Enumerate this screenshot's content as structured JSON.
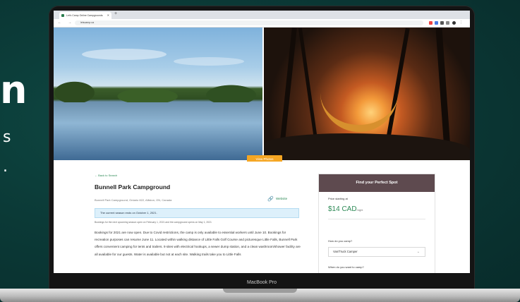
{
  "background": {
    "letter": "n",
    "line2": "s",
    "line3": "."
  },
  "device": {
    "label": "MacBook Pro"
  },
  "browser": {
    "tab_title": "Let's Camp Online Campgrounds",
    "url": "letscamp.ca",
    "nav_icons": "← → ⟳"
  },
  "hero": {
    "view_photos_label": "View Photos"
  },
  "listing": {
    "back_label": "← Back to Search",
    "title": "Bunnell Park Campground",
    "address": "Bunnell Park Campground, Ontario 822, Alliston, ON, Canada",
    "website_label": "Website",
    "notice": "The current season ends on October 1, 2021.",
    "small_note": "Bookings for the next upcoming season open on February 1, 2021 and the campground opens on May 1, 2021",
    "description": "Bookings for 2021 are now open. Due to Covid restrictions, the camp is only available to essential workers until June 10. Bookings for recreation purposes can resume June 11. Located within walking distance of Little Falls Golf Course and picturesque Little Falls, Bunnell Park offers convenient camping for tents and trailers. 9 sites with electrical hookups, a sewer dump station, and a clean washroom/shower facility are all available for our guests. Water is available but not at each site. Walking trails take you to Little Falls"
  },
  "booking": {
    "header": "Find your Perfect Spot",
    "price_label": "Price starting at",
    "price": "$14 CAD",
    "per_night": "/night",
    "camp_question": "How do you camp?",
    "camp_selected": "Van/Truck Camper",
    "when_question": "When do you want to camp?"
  },
  "colors": {
    "accent_green": "#2e8b57",
    "widget_header": "#5e4a4f",
    "view_photos": "#f5a623",
    "notice_bg": "#ddf0fb"
  }
}
